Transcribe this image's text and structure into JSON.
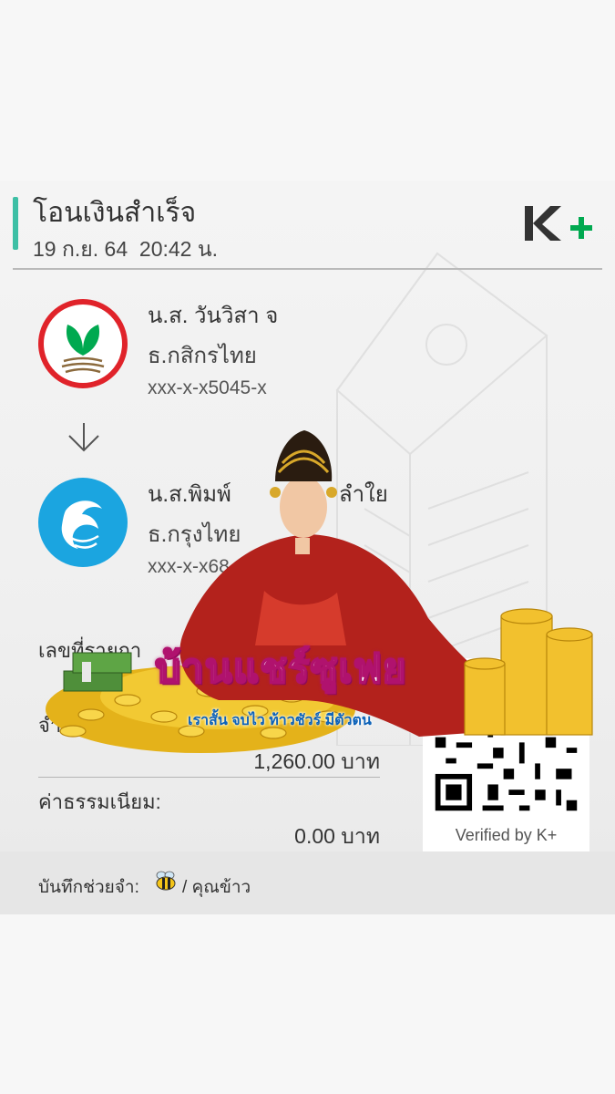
{
  "header": {
    "title": "โอนเงินสำเร็จ",
    "date": "19 ก.ย. 64",
    "time": "20:42 น.",
    "logo_text": "K+"
  },
  "sender": {
    "name": "น.ส. วันวิสา จ",
    "bank": "ธ.กสิกรไทย",
    "account": "xxx-x-x5045-x"
  },
  "receiver": {
    "name": "น.ส.พิมพ์",
    "name_tail": "ลำใย",
    "bank": "ธ.กรุงไทย",
    "account": "xxx-x-x68"
  },
  "details": {
    "ref_label": "เลขที่รายกา",
    "amount_label_fragment": "จำ",
    "amount_value": "1,260.00 บาท",
    "fee_label": "ค่าธรรมเนียม:",
    "fee_value": "0.00 บาท"
  },
  "qr": {
    "verified_text": "Verified by K+"
  },
  "memo": {
    "label": "บันทึกช่วยจำ:",
    "text": "/ คุณข้าว"
  },
  "sticker": {
    "title": "บ้านแชร์ซูเฟย",
    "subtitle": "เราสั้น จบไว ท้าวชัวร์ มีตัวตน"
  },
  "colors": {
    "accent": "#3dbfa5",
    "kbank_red": "#e0232a",
    "kbank_green": "#00a950",
    "ktb_blue": "#1ba5e0",
    "kplus_green": "#00a950"
  },
  "icons": {
    "arrow": "arrow-down-icon",
    "memo_emoji": "bee-icon"
  }
}
